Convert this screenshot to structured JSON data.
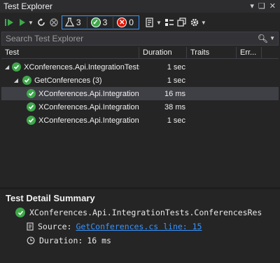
{
  "window": {
    "title": "Test Explorer",
    "controls": [
      "▾",
      "❑",
      "✕"
    ]
  },
  "toolbar": {
    "count_total": "3",
    "count_passed": "3",
    "count_failed": "0"
  },
  "search": {
    "placeholder": "Search Test Explorer"
  },
  "columns": {
    "test": "Test",
    "duration": "Duration",
    "traits": "Traits",
    "error": "Err..."
  },
  "rows": [
    {
      "name": "XConferences.Api.IntegrationTests",
      "duration": "1 sec"
    },
    {
      "name": "GetConferences (3)",
      "duration": "1 sec"
    },
    {
      "name": "XConferences.Api.IntegrationTests.ConferencesRes",
      "duration": "16 ms"
    },
    {
      "name": "XConferences.Api.IntegrationTests.ConferencesRes",
      "duration": "38 ms"
    },
    {
      "name": "XConferences.Api.IntegrationTests.ConferencesRes",
      "duration": "1 sec"
    }
  ],
  "detail": {
    "title": "Test Detail Summary",
    "test_name": "XConferences.Api.IntegrationTests.ConferencesRes",
    "source_label": "Source:",
    "source_link": "GetConferences.cs line: 15",
    "duration_label": "Duration:",
    "duration_value": "16 ms"
  },
  "colors": {
    "pass": "#3fa84b",
    "fail": "#e51400",
    "accent": "#3399ff",
    "link": "#3794ff"
  }
}
